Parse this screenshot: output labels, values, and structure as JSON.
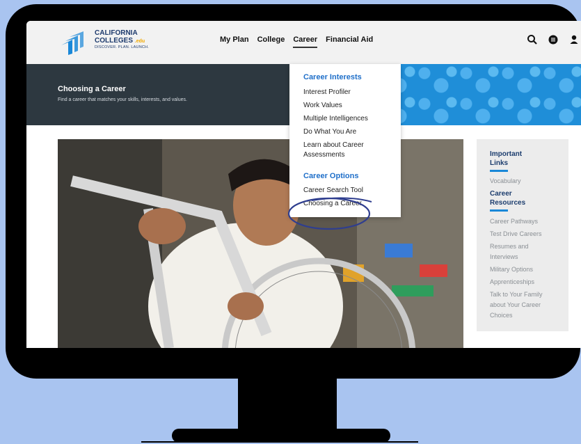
{
  "logo": {
    "line1": "CALIFORNIA",
    "line2": "COLLEGES",
    "edu": ".edu",
    "tagline": "DISCOVER. PLAN. LAUNCH."
  },
  "nav": {
    "items": [
      "My Plan",
      "College",
      "Career",
      "Financial Aid"
    ],
    "active": "Career"
  },
  "hero": {
    "title": "Choosing a Career",
    "subtitle": "Find a career that matches your skills, interests, and values."
  },
  "dropdown": {
    "section1_title": "Career Interests",
    "section1_items": [
      "Interest Profiler",
      "Work Values",
      "Multiple Intelligences",
      "Do What You Are",
      "Learn about Career",
      "Assessments"
    ],
    "section2_title": "Career Options",
    "section2_items": [
      "Career Search Tool",
      "Choosing a Career"
    ]
  },
  "sidebar": {
    "heading1_line1": "Important",
    "heading1_line2": "Links",
    "link_vocab": "Vocabulary",
    "heading2_line1": "Career",
    "heading2_line2": "Resources",
    "links": [
      "Career Pathways",
      "Test Drive Careers",
      "Resumes and",
      "Interviews",
      "Military Options",
      "Apprenticeships",
      "Talk to Your Family",
      "about Your Career",
      "Choices"
    ]
  },
  "colors": {
    "brand_navy": "#1c3d6e",
    "accent_blue": "#1f6fc9",
    "hero_dark": "#2d3840",
    "annotation": "#2f3e8f"
  }
}
